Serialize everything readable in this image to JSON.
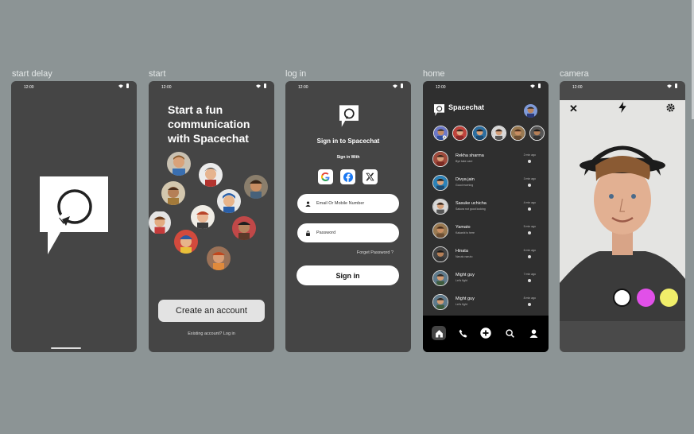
{
  "frames": {
    "start_delay": "start delay",
    "start": "start",
    "login": "log in",
    "home": "home",
    "camera": "camera"
  },
  "status_time": "12:00",
  "start": {
    "title": "Start a fun communication with Spacechat",
    "create_button": "Create an account",
    "existing": "Existing account? Log in"
  },
  "login": {
    "title": "Sign in to Spacechat",
    "sign_in_with": "Sign in With",
    "email_placeholder": "Email Or Mobile Number",
    "password_placeholder": "Password",
    "forgot": "Forget Password ?",
    "signin_button": "Sign in",
    "social_icons": [
      "google-icon",
      "facebook-icon",
      "x-icon"
    ]
  },
  "home": {
    "title": "Spacechat",
    "chats": [
      {
        "name": "Rekha sharma",
        "message": "Bye take care",
        "time": "2 min ago"
      },
      {
        "name": "Divya jain",
        "message": "Good morning",
        "time": "3 min ago"
      },
      {
        "name": "Sasuke uchicha",
        "message": "Sakura not good looking",
        "time": "4 min ago"
      },
      {
        "name": "Yamato",
        "message": "Kakashi is here",
        "time": "5 min ago"
      },
      {
        "name": "Hinata",
        "message": "Naruto naruto",
        "time": "6 min ago"
      },
      {
        "name": "Might guy",
        "message": "Let's fight",
        "time": "7 min ago"
      },
      {
        "name": "Might guy",
        "message": "Let's fight",
        "time": "8 min ago"
      }
    ],
    "tabs": [
      "home-icon",
      "phone-icon",
      "add-icon",
      "search-icon",
      "profile-icon"
    ]
  },
  "camera": {
    "filters": [
      "#ffffff",
      "#e150e8",
      "#f0ee6a"
    ]
  },
  "colors": {
    "background": "#8c9495",
    "screen": "#454545",
    "home_bg": "#2f2f2f",
    "accent_pink": "#e150e8",
    "accent_yellow": "#f0ee6a"
  }
}
